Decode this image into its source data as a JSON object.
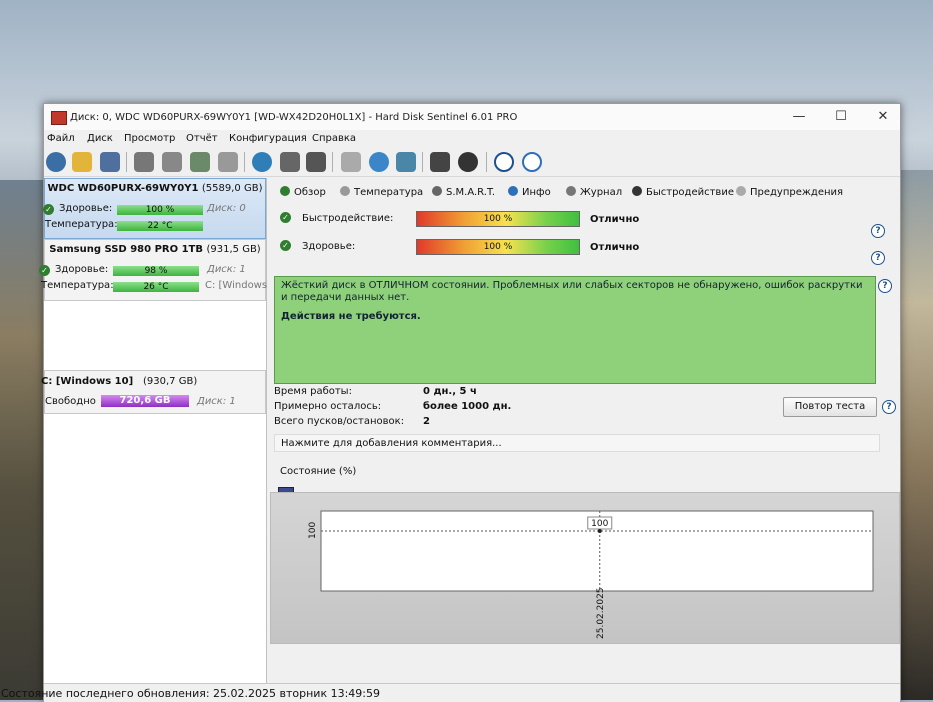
{
  "window": {
    "title": "Диск: 0, WDC WD60PURX-69WY0Y1 [WD-WX42D20H0L1X]  -  Hard Disk Sentinel 6.01 PRO",
    "min": "—",
    "max": "☐",
    "close": "✕"
  },
  "menu": [
    "Файл",
    "Диск",
    "Просмотр",
    "Отчёт",
    "Конфигурация",
    "Справка"
  ],
  "disks": [
    {
      "title": "WDC WD60PURX-69WY0Y1",
      "size": "(5589,0 GB)",
      "health_label": "Здоровье:",
      "health_value": "100 %",
      "health_pct": 100,
      "disk_index": "Диск: 0",
      "temp_label": "Температура:",
      "temp_value": "22 °C"
    },
    {
      "title": "Samsung SSD 980 PRO 1TB",
      "size": "(931,5 GB)",
      "health_label": "Здоровье:",
      "health_value": "98 %",
      "health_pct": 98,
      "disk_index": "Диск: 1",
      "temp_label": "Температура:",
      "temp_value": "26 °C",
      "volume_hint": "C: [Windows"
    }
  ],
  "volume": {
    "name": "C: [Windows 10]",
    "size": "(930,7 GB)",
    "free_label": "Свободно",
    "free_value": "720,6 GB",
    "disk_index": "Диск: 1"
  },
  "tabs": [
    "Обзор",
    "Температура",
    "S.M.A.R.T.",
    "Инфо",
    "Журнал",
    "Быстродействие",
    "Предупреждения"
  ],
  "performance": {
    "label": "Быстродействие:",
    "value": "100 %",
    "pct": 100,
    "rating": "Отлично"
  },
  "health": {
    "label": "Здоровье:",
    "value": "100 %",
    "pct": 100,
    "rating": "Отлично"
  },
  "message": {
    "text": "Жёсткий диск в ОТЛИЧНОМ состоянии. Проблемных или слабых секторов не обнаружено, ошибок раскрутки и передачи данных нет.",
    "action": "Действия не требуются."
  },
  "info": {
    "uptime_label": "Время работы:",
    "uptime_value": "0 дн., 5 ч",
    "remaining_label": "Примерно осталось:",
    "remaining_value": "более 1000 дн.",
    "starts_label": "Всего пусков/остановок:",
    "starts_value": "2"
  },
  "retest_button": "Повтор теста",
  "comment_placeholder": "Нажмите для добавления комментария...",
  "chart_section_label": "Состояние (%)",
  "chart_data": {
    "type": "line",
    "x": [
      "25.02.2025"
    ],
    "series": [
      {
        "values": [
          100
        ]
      }
    ],
    "ylabel": "",
    "xlabel": "",
    "y_tick": "100",
    "point_label": "100",
    "ylim": [
      0,
      100
    ]
  },
  "status_bar": "Состояние последнего обновления: 25.02.2025 вторник 13:49:59",
  "colors": {
    "health_green": "#3fb33f",
    "message_bg": "#8fd07a",
    "free_space": "#8e2ec4",
    "selection": "#c6d9ef"
  }
}
